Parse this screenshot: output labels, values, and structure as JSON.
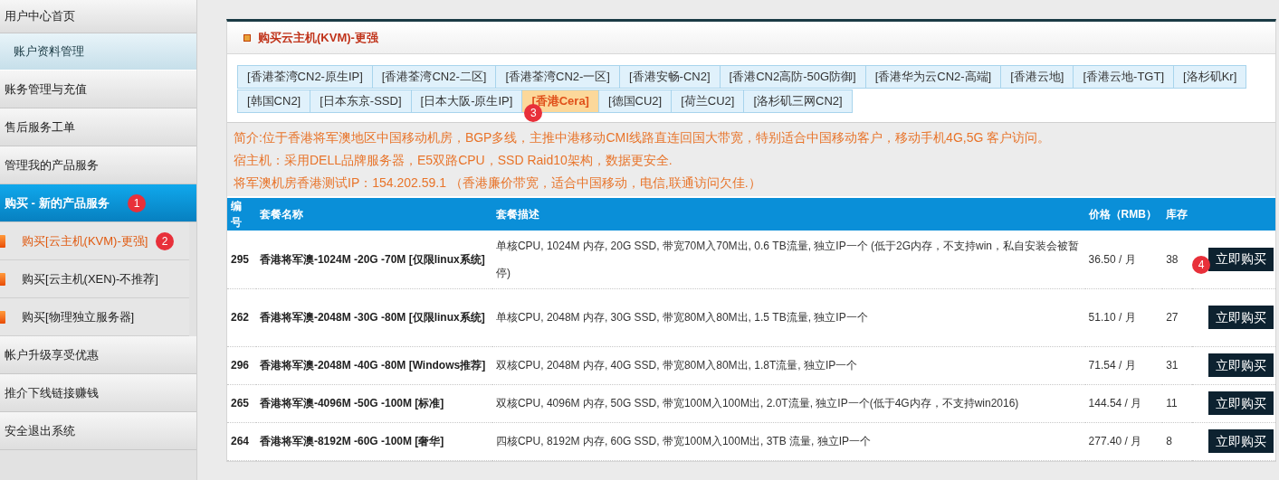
{
  "sidebar": {
    "items": [
      {
        "label": "用户中心首页",
        "kind": "main",
        "selected": false
      },
      {
        "label": "账户资料管理",
        "kind": "sub-highlight",
        "selected": false
      },
      {
        "label": "账务管理与充值",
        "kind": "main",
        "selected": false
      },
      {
        "label": "售后服务工单",
        "kind": "main",
        "selected": false
      },
      {
        "label": "管理我的产品服务",
        "kind": "main",
        "selected": false
      },
      {
        "label": "购买 - 新的产品服务",
        "kind": "main",
        "selected": true,
        "badge": "1"
      },
      {
        "label": "购买[云主机(KVM)-更强]",
        "kind": "child",
        "selected": true,
        "badge": "2"
      },
      {
        "label": "购买[云主机(XEN)-不推荐]",
        "kind": "child",
        "selected": false
      },
      {
        "label": "购买[物理独立服务器]",
        "kind": "child",
        "selected": false
      },
      {
        "label": "帐户升级享受优惠",
        "kind": "main",
        "selected": false
      },
      {
        "label": "推介下线链接赚钱",
        "kind": "main",
        "selected": false
      },
      {
        "label": "安全退出系统",
        "kind": "main",
        "selected": false
      }
    ]
  },
  "panel": {
    "title": "购买云主机(KVM)-更强",
    "tab_rows": [
      [
        {
          "label": "[香港荃湾CN2-原生IP]",
          "selected": false
        },
        {
          "label": "[香港荃湾CN2-二区]",
          "selected": false
        },
        {
          "label": "[香港荃湾CN2-一区]",
          "selected": false
        },
        {
          "label": "[香港安畅-CN2]",
          "selected": false
        },
        {
          "label": "[香港CN2高防-50G防御]",
          "selected": false
        },
        {
          "label": "[香港华为云CN2-高端]",
          "selected": false
        },
        {
          "label": "[香港云地]",
          "selected": false
        },
        {
          "label": "[香港云地-TGT]",
          "selected": false
        },
        {
          "label": "[洛杉矶Kr]",
          "selected": false
        }
      ],
      [
        {
          "label": "[韩国CN2]",
          "selected": false
        },
        {
          "label": "[日本东京-SSD]",
          "selected": false
        },
        {
          "label": "[日本大阪-原生IP]",
          "selected": false
        },
        {
          "label": "[香港Cera]",
          "selected": true,
          "badge": "3"
        },
        {
          "label": "[德国CU2]",
          "selected": false
        },
        {
          "label": "[荷兰CU2]",
          "selected": false
        },
        {
          "label": "[洛杉矶三网CN2]",
          "selected": false
        }
      ]
    ],
    "description": [
      "简介:位于香港将军澳地区中国移动机房，BGP多线，主推中港移动CMI线路直连回国大带宽，特别适合中国移动客户，移动手机4G,5G 客户访问。",
      "宿主机：采用DELL品牌服务器，E5双路CPU，SSD Raid10架构，数据更安全.",
      "将军澳机房香港测试IP：154.202.59.1 （香港廉价带宽，适合中国移动，电信,联通访问欠佳.）"
    ],
    "table": {
      "columns": [
        "编号",
        "套餐名称",
        "套餐描述",
        "价格（RMB）",
        "库存"
      ],
      "rows": [
        {
          "id": "295",
          "name": "香港将军澳-1024M -20G -70M [仅限linux系统]",
          "description": "单核CPU, 1024M 内存, 20G SSD, 带宽70M入70M出, 0.6 TB流量, 独立IP一个 (低于2G内存，不支持win，私自安装会被暂停)",
          "price": "36.50 / 月",
          "stock": "38",
          "button": "立即购买",
          "badge": "4"
        },
        {
          "id": "262",
          "name": "香港将军澳-2048M -30G -80M [仅限linux系统]",
          "description": "单核CPU, 2048M 内存, 30G SSD, 带宽80M入80M出, 1.5 TB流量, 独立IP一个",
          "price": "51.10 / 月",
          "stock": "27",
          "button": "立即购买"
        },
        {
          "id": "296",
          "name": "香港将军澳-2048M -40G -80M [Windows推荐]",
          "description": "双核CPU, 2048M 内存, 40G SSD, 带宽80M入80M出, 1.8T流量, 独立IP一个",
          "price": "71.54 / 月",
          "stock": "31",
          "button": "立即购买"
        },
        {
          "id": "265",
          "name": "香港将军澳-4096M -50G -100M [标准]",
          "description": "双核CPU, 4096M 内存, 50G SSD, 带宽100M入100M出, 2.0T流量, 独立IP一个(低于4G内存，不支持win2016)",
          "price": "144.54 / 月",
          "stock": "11",
          "button": "立即购买"
        },
        {
          "id": "264",
          "name": "香港将军澳-8192M -60G -100M [奢华]",
          "description": "四核CPU, 8192M 内存, 60G SSD, 带宽100M入100M出, 3TB 流量, 独立IP一个",
          "price": "277.40 / 月",
          "stock": "8",
          "button": "立即购买"
        }
      ]
    }
  }
}
